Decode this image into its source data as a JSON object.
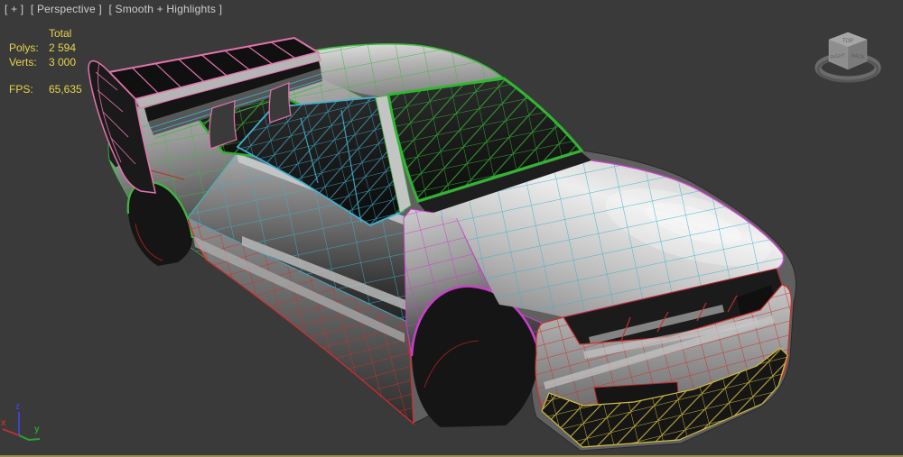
{
  "viewport": {
    "background_color": "#3a3a3a",
    "active_border_color": "#9a8a52",
    "label": {
      "general": "[ + ]",
      "point_of_view": "[ Perspective ]",
      "shading": "[ Smooth + Highlights ]"
    }
  },
  "statistics": {
    "text_color": "#e8d44a",
    "header": "Total",
    "rows": [
      {
        "label": "Polys:",
        "value": "2 594"
      },
      {
        "label": "Verts:",
        "value": "3 000"
      }
    ],
    "fps": {
      "label": "FPS:",
      "value": "65,635"
    }
  },
  "viewcube": {
    "faces": {
      "top": "TOP",
      "right": "RIGHT",
      "back": "BACK"
    }
  },
  "axis_tripod": {
    "x": {
      "label": "x",
      "color": "#c03030"
    },
    "y": {
      "label": "y",
      "color": "#30a030"
    },
    "z": {
      "label": "z",
      "color": "#3945cc"
    }
  },
  "scene": {
    "object": "car body mesh shell",
    "wireframe_colors": {
      "roof_and_rear": "#3dbb3d",
      "doors_hood": "#3fb0d0",
      "spoiler": "#e473ae",
      "front_fender": "#c940c9",
      "bumper_rocker": "#d02c2c",
      "front_splitter": "#d2bc3e"
    }
  }
}
